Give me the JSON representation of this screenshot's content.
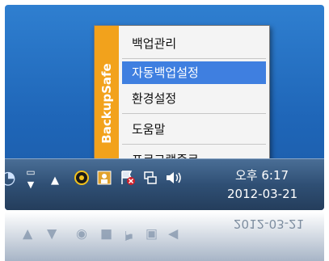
{
  "menu": {
    "side_label": "BackupSafe",
    "items": [
      {
        "label": "백업관리"
      },
      {
        "label": "자동백업설정"
      },
      {
        "label": "환경설정"
      },
      {
        "label": "도움말"
      },
      {
        "label": "프로그램종료"
      }
    ],
    "selected_index": 1
  },
  "taskbar": {
    "clock_time": "오후 6:17",
    "clock_date": "2012-03-21"
  },
  "reflection": {
    "date": "2012-03-21"
  },
  "colors": {
    "desktop": "#1f66b8",
    "menu_side": "#f2a21c",
    "menu_selected": "#3f7fe0",
    "taskbar": "#2f4f74"
  }
}
